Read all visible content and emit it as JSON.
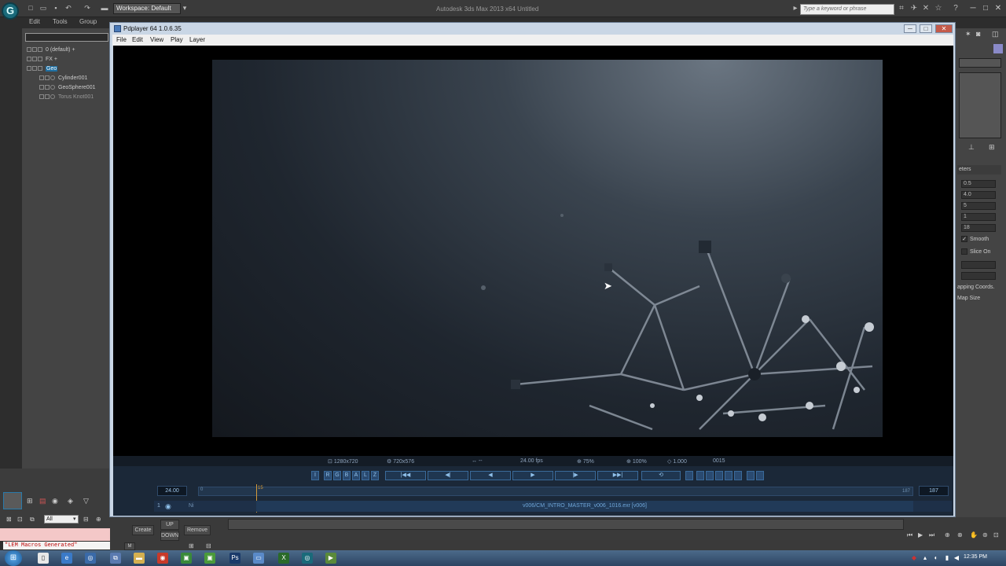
{
  "max": {
    "workspace": "Workspace: Default",
    "title": "Autodesk 3ds Max  2013 x64      Untitled",
    "search_placeholder": "Type a keyword or phrase",
    "menu": [
      "Edit",
      "Tools",
      "Group"
    ],
    "logo_letter": "G"
  },
  "scene": {
    "items": [
      {
        "label": "0 (default) +"
      },
      {
        "label": "FX +"
      },
      {
        "label": "Geo"
      },
      {
        "label": "Cylinder001"
      },
      {
        "label": "GeoSphere001"
      },
      {
        "label": "Torus Knot001"
      }
    ]
  },
  "pdplayer": {
    "title": "Pdplayer 64 1.0.6.35",
    "menu": [
      "File",
      "Edit",
      "View",
      "Play",
      "Layer"
    ],
    "info": {
      "resolution": "1280x720",
      "render_res": "720x576",
      "arrows": "↔ --",
      "fps": "24.00 fps",
      "zoom": "75%",
      "scale": "100%",
      "aspect": "1.000",
      "frame": "0015"
    },
    "fps_value": "24.00",
    "timeline_start": "0",
    "timeline_current": "15",
    "timeline_end_label": "187",
    "end_frame": "187",
    "layer": {
      "index": "1",
      "flag": "Ni",
      "name": "v006/CM_INTRO_MASTER_v006_1016.exr [v006]"
    },
    "channels": [
      "I",
      "R",
      "G",
      "B",
      "A",
      "L",
      "Z"
    ]
  },
  "command_panel": {
    "section": "eters",
    "spinners": [
      "0.5",
      "4.0",
      "5",
      "1",
      "18"
    ],
    "smooth": "Smooth",
    "slice_on": "Slice On",
    "mapping": "apping Coords.",
    "map_size": "Map Size"
  },
  "bottom": {
    "create": "Create",
    "up": "UP",
    "down": "DOWN",
    "remove": "Remove",
    "filter": "All",
    "macro": "\"LEM Macros Generated\""
  },
  "taskbar": {
    "clock": "12:35 PM"
  }
}
